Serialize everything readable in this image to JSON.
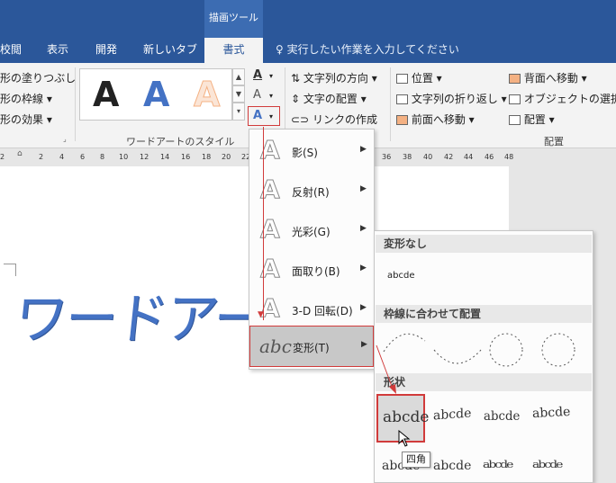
{
  "window": {
    "context_group": "描画ツール"
  },
  "tabs": [
    {
      "label": "校閲",
      "active": false
    },
    {
      "label": "表示",
      "active": false
    },
    {
      "label": "開発",
      "active": false
    },
    {
      "label": "新しいタブ",
      "active": false
    },
    {
      "label": "書式",
      "active": true
    }
  ],
  "tell_me": {
    "text": "実行したい作業を入力してください"
  },
  "ribbon": {
    "shape_styles": {
      "fill": "形の塗りつぶし",
      "outline": "形の枠線",
      "effects": "形の効果"
    },
    "wordart": {
      "label": "ワードアートのスタイル",
      "styles": [
        {
          "glyph": "A",
          "color": "#000000"
        },
        {
          "glyph": "A",
          "color": "#4472c4"
        },
        {
          "glyph": "A",
          "color": "#f4b183"
        }
      ]
    },
    "text": {
      "direction": "文字列の方向",
      "align": "文字の配置",
      "link": "リンクの作成"
    },
    "arrange": {
      "position": "位置",
      "wrap": "文字列の折り返し",
      "forward": "前面へ移動",
      "backward": "背面へ移動",
      "selection": "オブジェクトの選択と表",
      "align": "配置",
      "label": "配置"
    }
  },
  "ruler": {
    "ticks": [
      "2",
      "2",
      "4",
      "6",
      "8",
      "10",
      "12",
      "14",
      "16",
      "18",
      "20",
      "22",
      "36",
      "38",
      "40",
      "42",
      "44",
      "46",
      "48"
    ]
  },
  "document": {
    "wordart_text": "ワードアート"
  },
  "text_effects_menu": [
    {
      "label": "影(S)",
      "icon": "shadow-icon"
    },
    {
      "label": "反射(R)",
      "icon": "reflection-icon"
    },
    {
      "label": "光彩(G)",
      "icon": "glow-icon"
    },
    {
      "label": "面取り(B)",
      "icon": "bevel-icon"
    },
    {
      "label": "3-D 回転(D)",
      "icon": "3d-rotation-icon"
    },
    {
      "label": "変形(T)",
      "icon": "transform-icon",
      "highlighted": true
    }
  ],
  "transform_icon_text": "abc",
  "transform_gallery": {
    "no_transform": {
      "heading": "変形なし",
      "sample": "abcde"
    },
    "follow_path": {
      "heading": "枠線に合わせて配置"
    },
    "warp": {
      "heading": "形状",
      "samples": [
        "abcde",
        "abcde",
        "abcde",
        "abcde",
        "abcde",
        "abcde",
        "abcde",
        "abcde"
      ]
    }
  },
  "tooltip": {
    "text": "四角"
  },
  "colors": {
    "accent": "#2b579a",
    "highlight_red": "#d13b3b",
    "wordart_blue": "#4472c4"
  }
}
